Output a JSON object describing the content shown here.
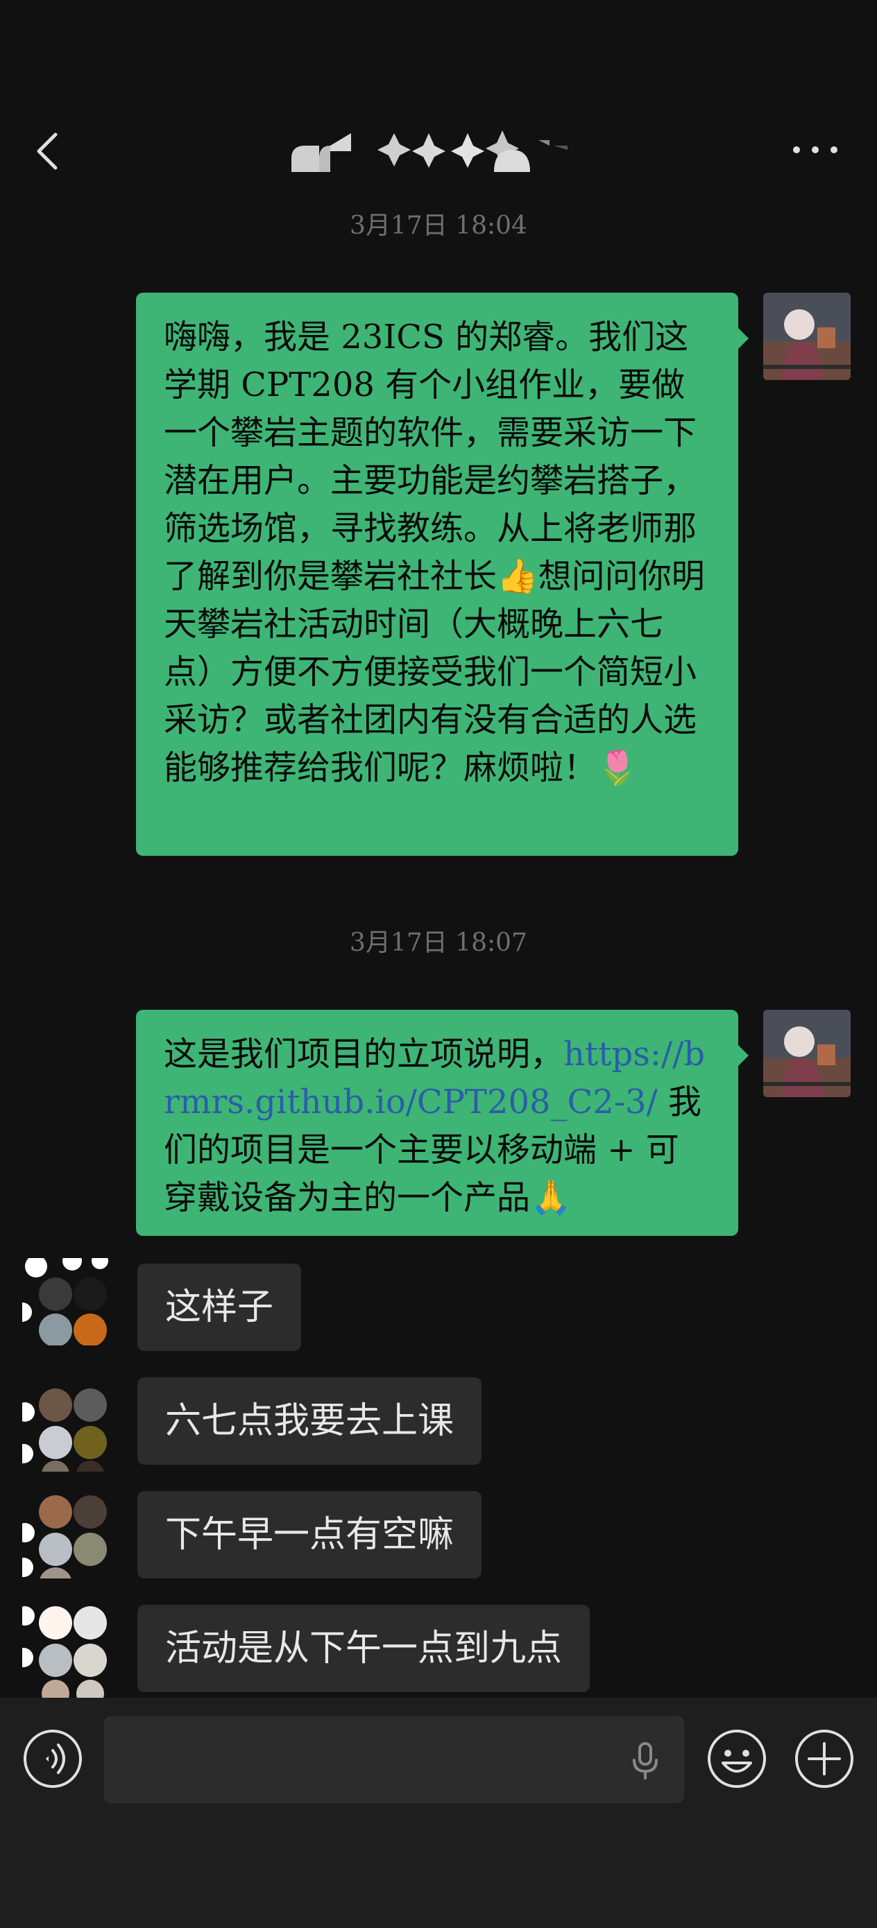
{
  "header": {
    "title": ""
  },
  "messages": {
    "ts1": "3月17日 18:04",
    "m1": "嗨嗨，我是 23ICS 的郑睿。我们这学期 CPT208 有个小组作业，要做一个攀岩主题的软件，需要采访一下潜在用户。主要功能是约攀岩搭子，筛选场馆，寻找教练。从上将老师那了解到你是攀岩社社长👍想问问你明天攀岩社活动时间（大概晚上六七点）方便不方便接受我们一个简短小采访？或者社团内有没有合适的人选能够推荐给我们呢？麻烦啦！🌷",
    "ts2": "3月17日 18:07",
    "m2_prefix": "这是我们项目的立项说明，",
    "m2_link": "https://brmrs.github.io/CPT208_C2-3/",
    "m2_suffix": " 我们的项目是一个主要以移动端 + 可穿戴设备为主的一个产品🙏",
    "r1": "这样子",
    "r2": "六七点我要去上课",
    "r3": "下午早一点有空嘛",
    "r4": "活动是从下午一点到九点"
  },
  "input": {
    "placeholder": ""
  },
  "icons": {
    "back": "chevron-left-icon",
    "more": "more-dots-icon",
    "voice": "voice-icon",
    "mic": "mic-icon",
    "emoji": "emoji-icon",
    "plus": "plus-icon"
  },
  "colors": {
    "background": "#111111",
    "outgoing_bubble": "#3eb575",
    "incoming_bubble": "#2c2c2c",
    "link": "#2a5ea8",
    "timestamp": "#6f6f6f"
  }
}
